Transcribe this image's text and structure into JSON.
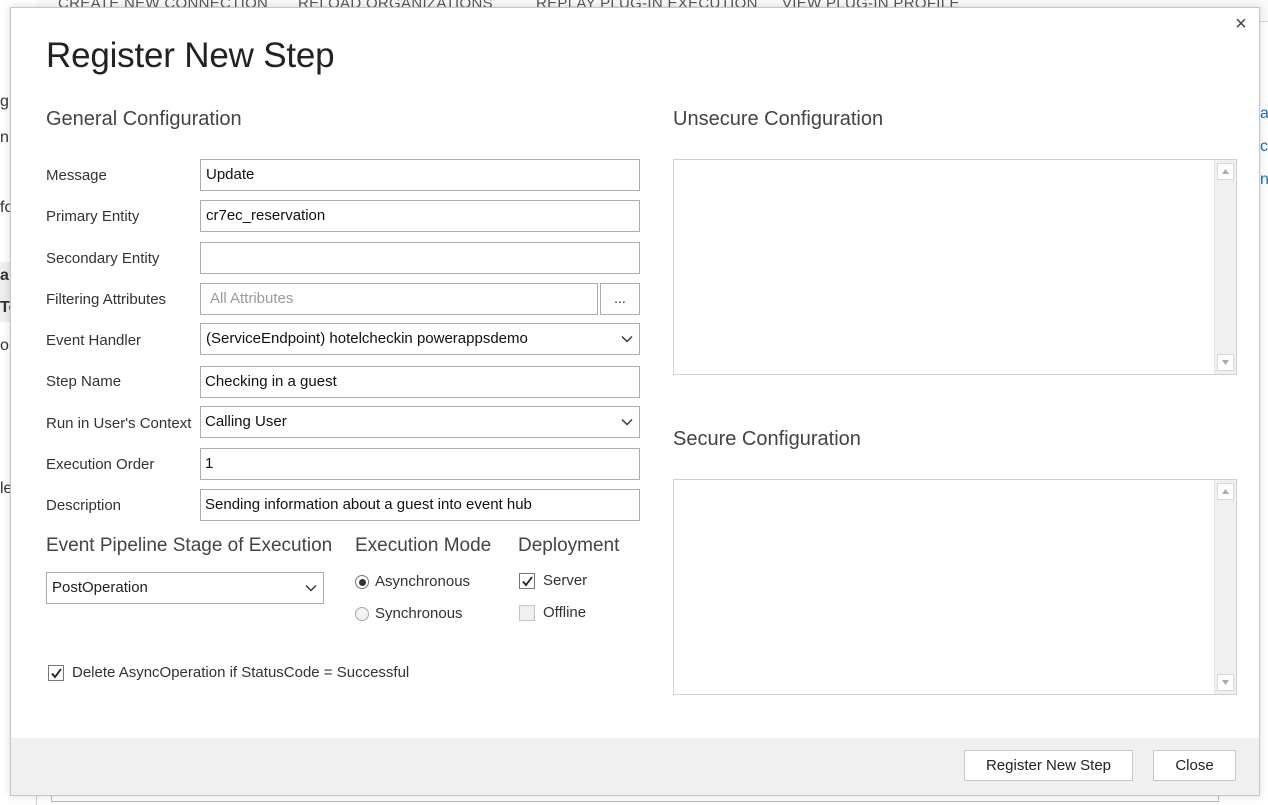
{
  "background": {
    "toolbar_items": [
      "CREATE NEW CONNECTION",
      "RELOAD ORGANIZATIONS",
      "REPLAY PLUG-IN EXECUTION",
      "VIEW PLUG-IN PROFILE"
    ],
    "left_fragments": [
      "g",
      "n A",
      "fo",
      "ar",
      "To",
      "oi",
      "le"
    ],
    "right_fragments": [
      "av",
      "ce",
      "n"
    ]
  },
  "dialog": {
    "title": "Register New Step",
    "close_glyph": "×",
    "general_title": "General Configuration",
    "fields": {
      "message": {
        "label": "Message",
        "value": "Update"
      },
      "primary_entity": {
        "label": "Primary Entity",
        "value": "cr7ec_reservation"
      },
      "secondary_entity": {
        "label": "Secondary Entity",
        "value": ""
      },
      "filtering_attributes": {
        "label": "Filtering Attributes",
        "placeholder": "All Attributes",
        "button": "..."
      },
      "event_handler": {
        "label": "Event Handler",
        "value": "(ServiceEndpoint) hotelcheckin powerappsdemo"
      },
      "step_name": {
        "label": "Step Name",
        "value": "Checking in a guest"
      },
      "run_context": {
        "label": "Run in User's Context",
        "value": "Calling User"
      },
      "execution_order": {
        "label": "Execution Order",
        "value": "1"
      },
      "description": {
        "label": "Description",
        "value": "Sending information about a guest into event hub"
      }
    },
    "pipeline": {
      "title": "Event Pipeline Stage of Execution",
      "value": "PostOperation"
    },
    "execution_mode": {
      "title": "Execution Mode",
      "options": [
        "Asynchronous",
        "Synchronous"
      ],
      "selected": "Asynchronous"
    },
    "deployment": {
      "title": "Deployment",
      "server": {
        "label": "Server",
        "checked": true
      },
      "offline": {
        "label": "Offline",
        "checked": false
      }
    },
    "delete_async": {
      "label": "Delete AsyncOperation if StatusCode = Successful",
      "checked": true
    },
    "unsecure_title": "Unsecure  Configuration",
    "secure_title": "Secure  Configuration",
    "buttons": {
      "register": "Register New Step",
      "close": "Close"
    }
  }
}
